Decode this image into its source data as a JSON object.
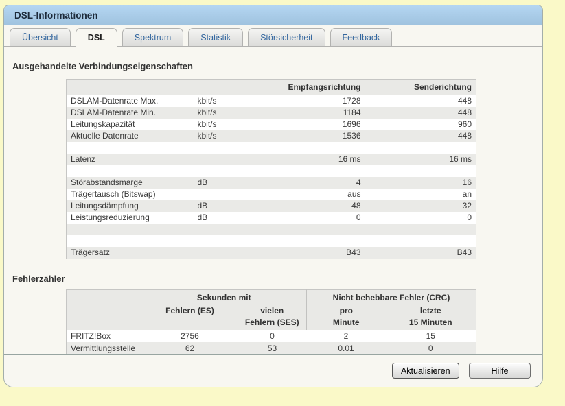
{
  "window": {
    "title": "DSL-Informationen"
  },
  "tabs": [
    {
      "label": "Übersicht",
      "active": false
    },
    {
      "label": "DSL",
      "active": true
    },
    {
      "label": "Spektrum",
      "active": false
    },
    {
      "label": "Statistik",
      "active": false
    },
    {
      "label": "Störsicherheit",
      "active": false
    },
    {
      "label": "Feedback",
      "active": false
    }
  ],
  "sections": {
    "connection": {
      "heading": "Ausgehandelte Verbindungseigenschaften",
      "table": {
        "columns": [
          "",
          "",
          "Empfangsrichtung",
          "Senderichtung"
        ],
        "rows": [
          [
            "DSLAM-Datenrate Max.",
            "kbit/s",
            "1728",
            "448"
          ],
          [
            "DSLAM-Datenrate Min.",
            "kbit/s",
            "1184",
            "448"
          ],
          [
            "Leitungskapazität",
            "kbit/s",
            "1696",
            "960"
          ],
          [
            "Aktuelle Datenrate",
            "kbit/s",
            "1536",
            "448"
          ],
          [
            "",
            "",
            "",
            ""
          ],
          [
            "Latenz",
            "",
            "16 ms",
            "16 ms"
          ],
          [
            "",
            "",
            "",
            ""
          ],
          [
            "Störabstandsmarge",
            "dB",
            "4",
            "16"
          ],
          [
            "Trägertausch (Bitswap)",
            "",
            "aus",
            "an"
          ],
          [
            "Leitungsdämpfung",
            "dB",
            "48",
            "32"
          ],
          [
            "Leistungsreduzierung",
            "dB",
            "0",
            "0"
          ],
          [
            "",
            "",
            "",
            ""
          ],
          [
            "",
            "",
            "",
            ""
          ],
          [
            "Trägersatz",
            "",
            "B43",
            "B43"
          ]
        ]
      }
    },
    "errors": {
      "heading": "Fehlerzähler",
      "table": {
        "group_headers": [
          "Sekunden mit",
          "Nicht behebbare Fehler (CRC)"
        ],
        "columns": [
          "",
          "Fehlern (ES)",
          "vielen\nFehlern (SES)",
          "pro\nMinute",
          "letzte\n15 Minuten"
        ],
        "rows": [
          [
            "FRITZ!Box",
            "2756",
            "0",
            "2",
            "15"
          ],
          [
            "Vermittlungsstelle",
            "62",
            "53",
            "0.01",
            "0"
          ]
        ]
      }
    }
  },
  "footer": {
    "buttons": [
      "Aktualisieren",
      "Hilfe"
    ]
  },
  "colors": {
    "page_background": "#faf9c8",
    "panel_background": "#f8f7f1",
    "titlebar_top": "#b4d6f2",
    "titlebar_bottom": "#9fc2de",
    "tab_link": "#33669e",
    "row_alt": "#eaeae7",
    "table_border": "#c6c6c4"
  }
}
